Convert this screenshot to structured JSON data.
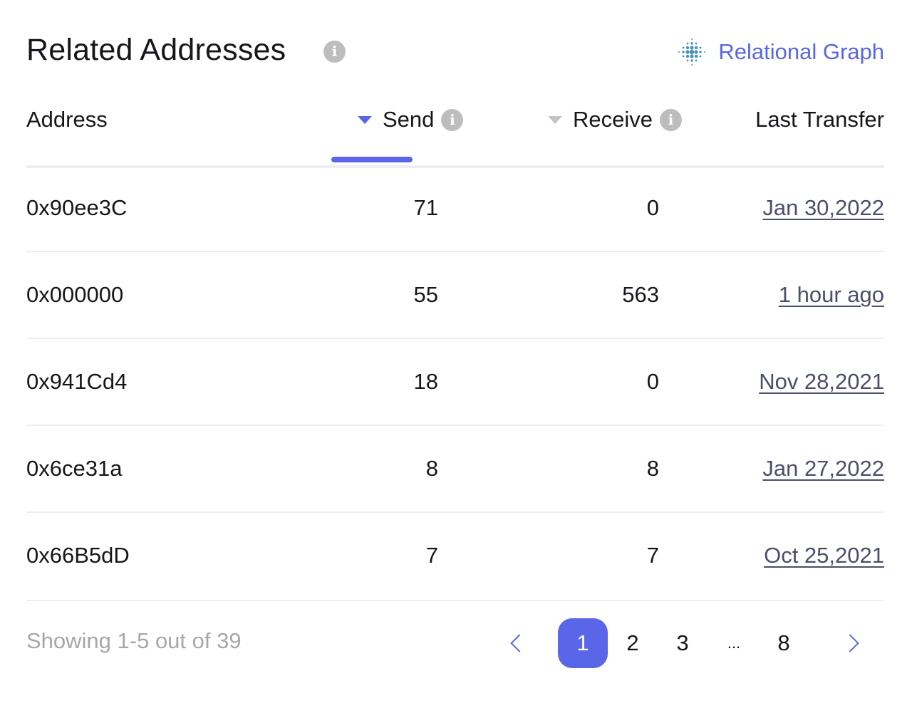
{
  "header": {
    "title": "Related Addresses",
    "info_icon": "info-icon",
    "graph_link": {
      "label": "Relational Graph",
      "icon": "dot-grid-icon"
    }
  },
  "table": {
    "columns": {
      "address": "Address",
      "send": "Send",
      "receive": "Receive",
      "last_transfer": "Last Transfer"
    },
    "sort": {
      "active_column": "send",
      "direction": "desc"
    },
    "rows": [
      {
        "address": "0x90ee3C",
        "send": "71",
        "receive": "0",
        "last_transfer": "Jan 30,2022"
      },
      {
        "address": "0x000000",
        "send": "55",
        "receive": "563",
        "last_transfer": "1 hour ago"
      },
      {
        "address": "0x941Cd4",
        "send": "18",
        "receive": "0",
        "last_transfer": "Nov 28,2021"
      },
      {
        "address": "0x6ce31a",
        "send": "8",
        "receive": "8",
        "last_transfer": "Jan 27,2022"
      },
      {
        "address": "0x66B5dD",
        "send": "7",
        "receive": "7",
        "last_transfer": "Oct 25,2021"
      }
    ]
  },
  "footer": {
    "showing": "Showing 1-5 out of 39",
    "pagination": {
      "current": "1",
      "pages": [
        "1",
        "2",
        "3",
        "...",
        "8"
      ],
      "prev_icon": "chevron-left-icon",
      "next_icon": "chevron-right-icon"
    }
  },
  "colors": {
    "accent": "#5a66e8",
    "muted": "#a7a7a7",
    "info_icon": "#bdbdbd",
    "link": "#4a4f6a"
  }
}
